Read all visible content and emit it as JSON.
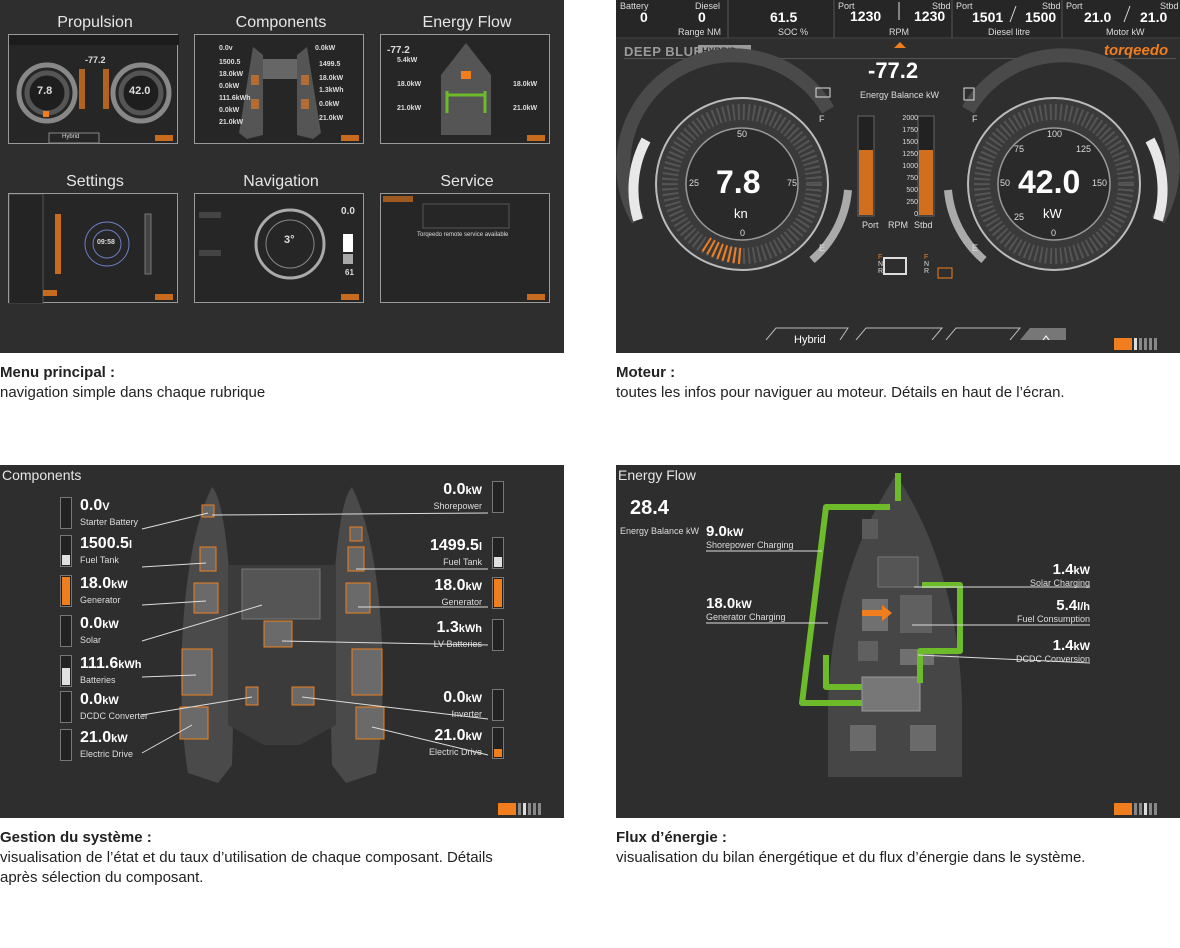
{
  "menu": {
    "tiles": [
      "Propulsion",
      "Components",
      "Energy Flow",
      "Settings",
      "Navigation",
      "Service"
    ],
    "propulsion_left": "7.8",
    "propulsion_right": "42.0",
    "propulsion_center": "-77.2",
    "components_values": [
      "0.0v",
      "1500.5",
      "18.0kW",
      "0.0kW",
      "111.6kWh",
      "0.0kW",
      "21.0kW",
      "0.0kW",
      "1499.5",
      "18.0kW",
      "1.3kWh",
      "0.0kW",
      "21.0kW"
    ],
    "energy_values": [
      "-77.2",
      "5.4kW",
      "18.0kW",
      "18.0kW",
      "21.0kW",
      "21.0kW"
    ],
    "settings_time": "09:58",
    "nav_heading": "3°",
    "nav_value_top": "0.0",
    "nav_value_bottom": "61",
    "service_line": "Torqeedo remote service available",
    "service_btn": "Hybrid"
  },
  "moteur": {
    "top": {
      "battery_label": "Battery",
      "battery_val": "0",
      "diesel_label": "Diesel",
      "diesel_val": "0",
      "range_label": "Range NM",
      "soc_val": "61.5",
      "soc_label": "SOC %",
      "rpm_port_label": "Port",
      "rpm_port": "1230",
      "rpm_stbd_label": "Stbd",
      "rpm_stbd": "1230",
      "rpm_label": "RPM",
      "diesel_port_label": "Port",
      "diesel_port": "1501",
      "diesel_stbd_label": "Stbd",
      "diesel_stbd": "1500",
      "diesel_litre_label": "Diesel litre",
      "motor_port_label": "Port",
      "motor_port": "21.0",
      "motor_stbd_label": "Stbd",
      "motor_stbd": "21.0",
      "motor_label": "Motor kW"
    },
    "brand_left": "DEEP BLUE",
    "brand_badge": "HYBRID",
    "brand_right": "torqeedo",
    "energy_balance": "-77.2",
    "energy_balance_label": "Energy Balance kW",
    "speed": "7.8",
    "speed_unit": "kn",
    "power": "42.0",
    "power_unit": "kW",
    "left_ticks": [
      "50",
      "25",
      "75",
      "0"
    ],
    "right_ticks": [
      "100",
      "75",
      "125",
      "50",
      "150",
      "25",
      "0"
    ],
    "rpm_scale": [
      "2000",
      "1750",
      "1500",
      "1250",
      "1000",
      "750",
      "500",
      "250",
      "0"
    ],
    "rpm_port_label": "Port",
    "rpm_mid_label": "RPM",
    "rpm_stbd_label": "Stbd",
    "f_left": "F",
    "e_left": "E",
    "f_right": "F",
    "e_right": "E",
    "gear_f": "F",
    "gear_n": "N",
    "gear_r": "R",
    "mode_button": "Hybrid"
  },
  "components": {
    "title": "Components",
    "left": [
      {
        "value": "0.0",
        "unit": "V",
        "name": "Starter Battery",
        "fill": 0
      },
      {
        "value": "1500.5",
        "unit": "l",
        "name": "Fuel Tank",
        "fill": 0.35
      },
      {
        "value": "18.0",
        "unit": "kW",
        "name": "Generator",
        "fill": 1
      },
      {
        "value": "0.0",
        "unit": "kW",
        "name": "Solar",
        "fill": 0
      },
      {
        "value": "111.6",
        "unit": "kWh",
        "name": "Batteries",
        "fill": 0.6
      },
      {
        "value": "0.0",
        "unit": "kW",
        "name": "DCDC Converter",
        "fill": 0
      },
      {
        "value": "21.0",
        "unit": "kW",
        "name": "Electric Drive",
        "fill": 0
      }
    ],
    "right": [
      {
        "value": "0.0",
        "unit": "kW",
        "name": "Shorepower",
        "fill": 0
      },
      {
        "value": "1499.5",
        "unit": "l",
        "name": "Fuel Tank",
        "fill": 0.35
      },
      {
        "value": "18.0",
        "unit": "kW",
        "name": "Generator",
        "fill": 1
      },
      {
        "value": "1.3",
        "unit": "kWh",
        "name": "LV Batteries",
        "fill": 0
      },
      {
        "value": "0.0",
        "unit": "kW",
        "name": "Inverter",
        "fill": 0
      },
      {
        "value": "21.0",
        "unit": "kW",
        "name": "Electric Drive",
        "fill": 0.3
      }
    ]
  },
  "energy_flow": {
    "title": "Energy Flow",
    "balance": "28.4",
    "balance_label": "Energy Balance kW",
    "items": [
      {
        "value": "9.0",
        "unit": "kW",
        "name": "Shorepower Charging"
      },
      {
        "value": "18.0",
        "unit": "kW",
        "name": "Generator Charging"
      },
      {
        "value": "1.4",
        "unit": "kW",
        "name": "Solar Charging"
      },
      {
        "value": "5.4",
        "unit": "l/h",
        "name": "Fuel Consumption"
      },
      {
        "value": "1.4",
        "unit": "kW",
        "name": "DCDC Conversion"
      }
    ]
  },
  "captions": [
    {
      "title": "Menu principal :",
      "text": "navigation simple dans chaque rubrique"
    },
    {
      "title": "Moteur :",
      "text": "toutes les infos pour naviguer au moteur. Détails en haut de l’écran."
    },
    {
      "title": "Gestion du système :",
      "text": "visualisation de l’état et du taux d’utilisation de chaque composant. Détails après sélection du composant."
    },
    {
      "title": "Flux d’énergie :",
      "text": "visualisation du bilan énergétique et du flux d’énergie dans le système."
    }
  ],
  "colors": {
    "bg": "#2e2e2e",
    "accent": "#f07d1e",
    "green": "#6dbb2a",
    "text": "#ffffff"
  }
}
